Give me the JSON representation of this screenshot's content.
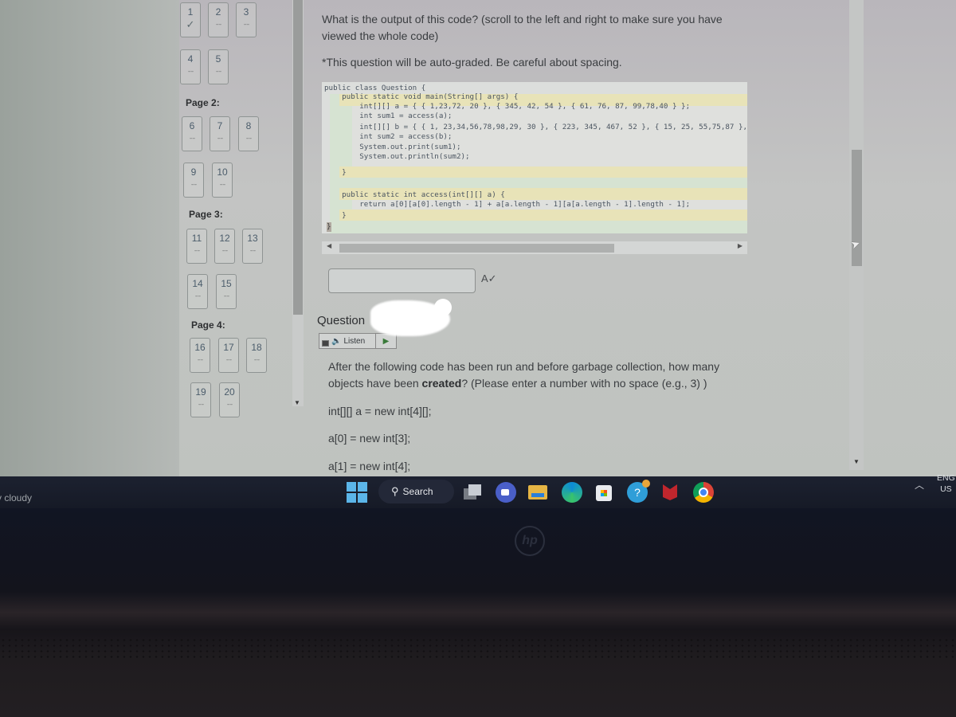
{
  "question_nav": {
    "pages": [
      {
        "label": "",
        "questions": [
          {
            "number": "1",
            "status": "answered",
            "mark": "✓"
          },
          {
            "number": "2",
            "status": "unanswered",
            "mark": "-- --"
          },
          {
            "number": "3",
            "status": "unanswered",
            "mark": "-- --"
          },
          {
            "number": "4",
            "status": "unanswered",
            "mark": "-- --"
          },
          {
            "number": "5",
            "status": "unanswered",
            "mark": "-- --"
          }
        ]
      },
      {
        "label": "Page 2:",
        "questions": [
          {
            "number": "6",
            "mark": "-- --"
          },
          {
            "number": "7",
            "mark": "-- --"
          },
          {
            "number": "8",
            "mark": "-- --"
          },
          {
            "number": "9",
            "mark": "-- --"
          },
          {
            "number": "10",
            "mark": "-- --"
          }
        ]
      },
      {
        "label": "Page 3:",
        "questions": [
          {
            "number": "11",
            "mark": "-- --"
          },
          {
            "number": "12",
            "mark": "-- --"
          },
          {
            "number": "13",
            "mark": "-- --"
          },
          {
            "number": "14",
            "mark": "-- --"
          },
          {
            "number": "15",
            "mark": "-- --"
          }
        ]
      },
      {
        "label": "Page 4:",
        "questions": [
          {
            "number": "16",
            "mark": "-- --"
          },
          {
            "number": "17",
            "mark": "-- --"
          },
          {
            "number": "18",
            "mark": "-- --"
          },
          {
            "number": "19",
            "mark": "-- --"
          },
          {
            "number": "20",
            "mark": "-- --"
          }
        ]
      }
    ]
  },
  "question1": {
    "prompt": "What is the output of this code? (scroll to the left and right to make sure you have viewed the whole code)",
    "note": "*This question will be auto-graded. Be careful about spacing.",
    "code_lines": [
      "public class Question {",
      "    public static void main(String[] args) {",
      "        int[][] a = { { 1,23,72, 20 }, { 345, 42, 54 }, { 61, 76, 87, 99,78,40 } };",
      "        int sum1 = access(a);",
      "        int[][] b = { { 1, 23,34,56,78,98,29, 30 }, { 223, 345, 467, 52 }, { 15, 25, 55,75,87 },",
      "        int sum2 = access(b);",
      "        System.out.print(sum1);",
      "        System.out.println(sum2);",
      "    }",
      "",
      "    public static int access(int[][] a) {",
      "        return a[0][a[0].length - 1] + a[a.length - 1][a[a.length - 1].length - 1];",
      "    }",
      "}"
    ],
    "answer_value": "",
    "spellcheck_icon": "A✓"
  },
  "question2": {
    "heading": "Question",
    "listen_label": "Listen",
    "text_before_bold": "After the following code has been run and before garbage collection, how many objects have been ",
    "text_bold": "created",
    "text_after_bold": "? (Please enter a number with no space (e.g., 3) )",
    "code_lines": [
      "int[][] a = new int[4][];",
      "a[0] = new int[3];",
      "a[1] = new int[4];"
    ]
  },
  "taskbar": {
    "weather": "y cloudy",
    "search_label": "Search",
    "apps": [
      "task-view",
      "meet",
      "file-explorer",
      "edge",
      "store",
      "help",
      "mcafee",
      "chrome"
    ],
    "language": "ENG",
    "region": "US"
  },
  "device": {
    "brand": "hp"
  }
}
